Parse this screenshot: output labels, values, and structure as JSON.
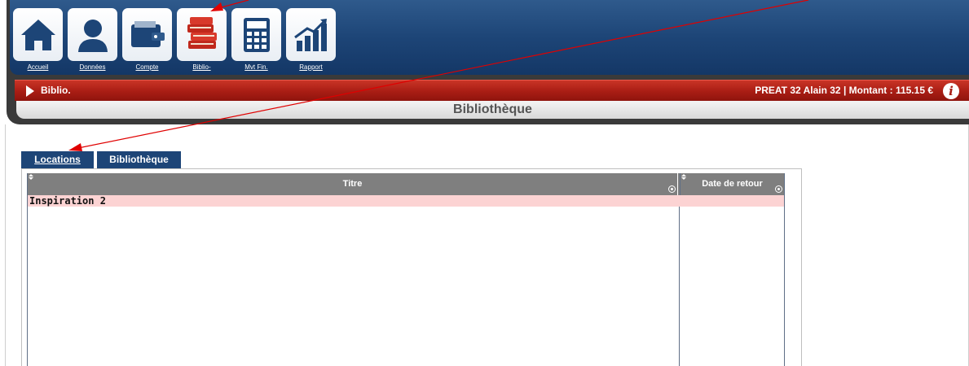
{
  "nav": {
    "items": [
      {
        "label": "Accueil",
        "icon": "home-icon"
      },
      {
        "label": "Données",
        "icon": "user-icon"
      },
      {
        "label": "Compte",
        "icon": "wallet-icon"
      },
      {
        "label": "Biblio-",
        "icon": "books-icon"
      },
      {
        "label": "Mvt Fin.",
        "icon": "calculator-icon"
      },
      {
        "label": "Rapport",
        "icon": "chart-icon"
      }
    ]
  },
  "status_bar": {
    "breadcrumb": "Biblio.",
    "user_info": "PREAT 32 Alain 32 | Montant : 115.15 €",
    "info_icon": "i"
  },
  "page": {
    "title": "Bibliothèque"
  },
  "tabs": [
    {
      "label": "Locations",
      "active": true
    },
    {
      "label": "Bibliothèque",
      "active": false
    }
  ],
  "grid": {
    "columns": [
      "Titre",
      "Date de retour"
    ],
    "rows": [
      {
        "titre": "Inspiration 2",
        "date_retour": ""
      }
    ]
  },
  "colors": {
    "header_blue": "#1d4577",
    "status_red": "#a81d14",
    "row_highlight": "#fcd3d3",
    "annotation": "#e00000"
  }
}
